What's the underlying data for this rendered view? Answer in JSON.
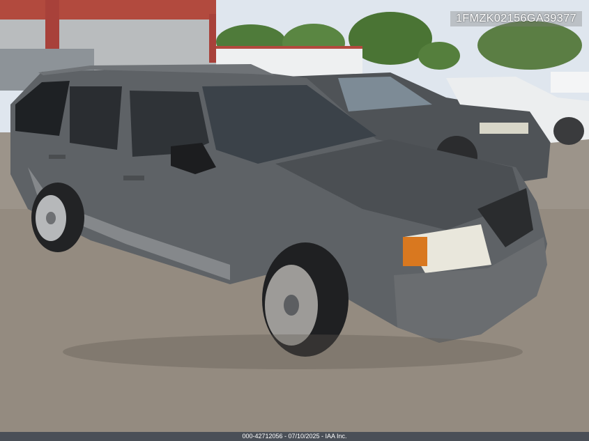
{
  "overlay": {
    "vin": "1FMZK02156GA39377"
  },
  "footer": {
    "caption": "000-42712056 - 07/10/2025 - IAA Inc."
  },
  "scene": {
    "subject": "damaged gray minivan parked on gravel lot",
    "colors": {
      "vehicle_body": "#5e6266",
      "ground": "#9c948a",
      "sky": "#dfe6ee",
      "foliage": "#4f7b3a"
    }
  }
}
